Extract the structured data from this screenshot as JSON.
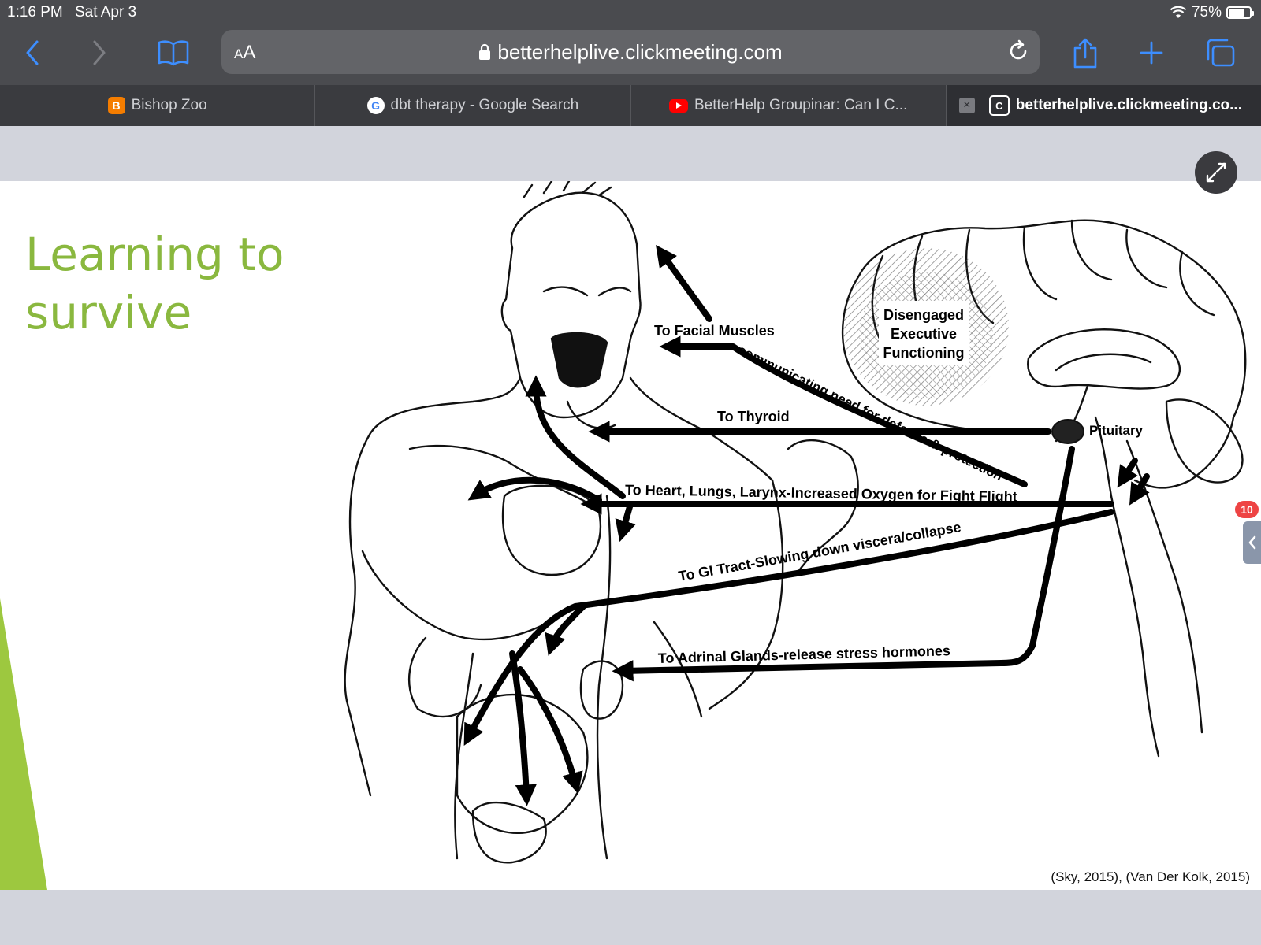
{
  "status": {
    "time": "1:16 PM",
    "date": "Sat Apr 3",
    "battery": "75%",
    "battery_level": 0.75
  },
  "address_bar": {
    "aa_small": "A",
    "aa_large": "A",
    "url": "betterhelplive.clickmeeting.com"
  },
  "tabs": [
    {
      "label": "Bishop Zoo",
      "favicon": "blogger-icon",
      "color": "#f57d00"
    },
    {
      "label": "dbt therapy - Google Search",
      "favicon": "google-icon",
      "color": "#4285f4"
    },
    {
      "label": "BetterHelp Groupinar: Can I C...",
      "favicon": "youtube-icon",
      "color": "#ff0000"
    },
    {
      "label": "betterhelplive.clickmeeting.co...",
      "favicon": "clickmeeting-icon",
      "active": true,
      "favicon_letter": "C"
    }
  ],
  "slide": {
    "title_line1": "Learning to",
    "title_line2": "survive",
    "citation": "(Sky, 2015), (Van Der Kolk, 2015)",
    "title_color": "#8ab83f",
    "accent_color": "#9dc83f"
  },
  "diagram_labels": {
    "facial": "To Facial Muscles",
    "communicating": "communicating need for defense & protection",
    "executive_1": "Disengaged",
    "executive_2": "Executive",
    "executive_3": "Functioning",
    "thyroid": "To Thyroid",
    "pituitary": "Pituitary",
    "heart": "To Heart, Lungs, Larynx-Increased Oxygen for Fight Flight",
    "gi": "To GI Tract-Slowing down viscera/collapse",
    "adrenal": "To Adrinal Glands-release stress hormones"
  },
  "chat_badge": "10"
}
